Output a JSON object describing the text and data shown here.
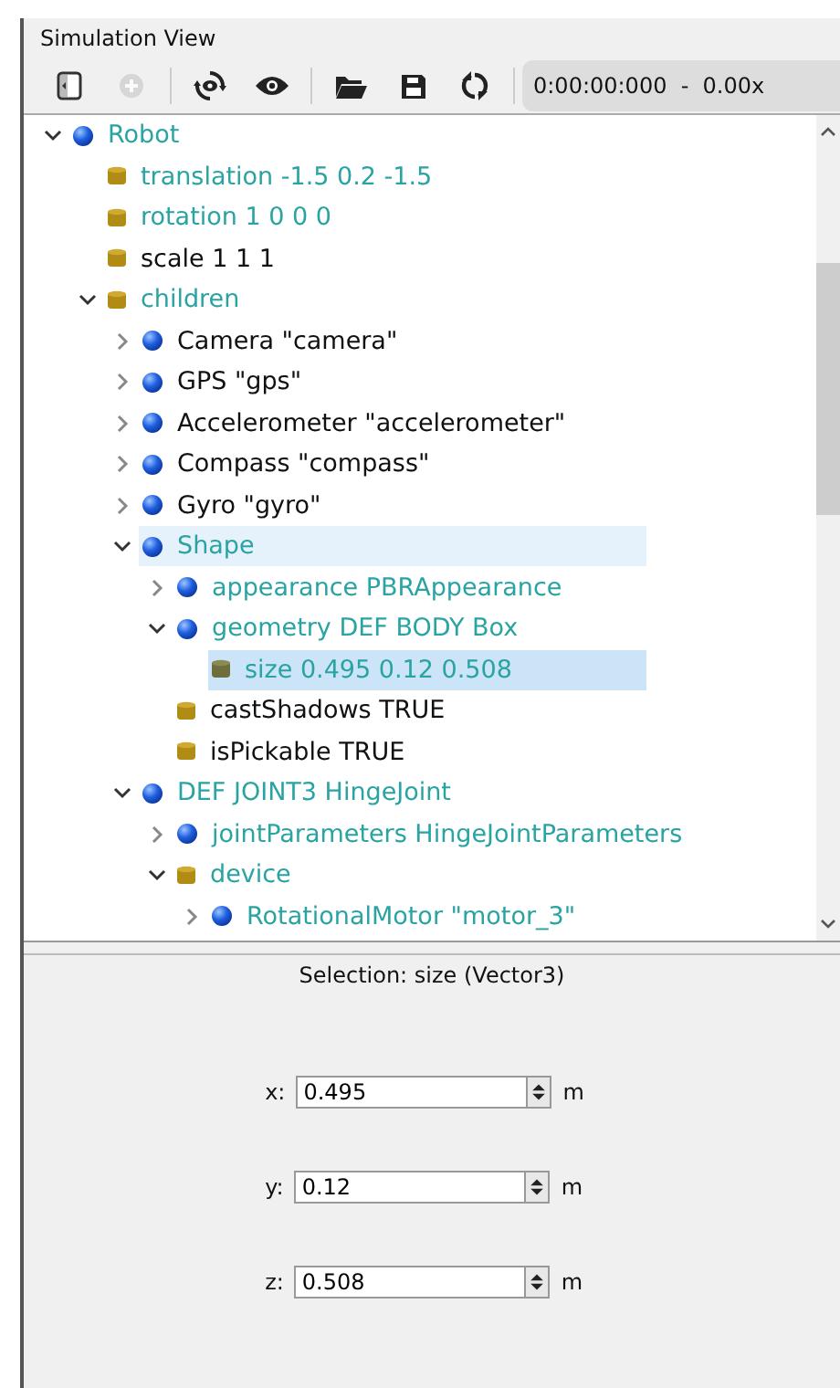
{
  "panel": {
    "title": "Simulation View"
  },
  "toolbar": {
    "buttons": [
      {
        "kind": "sidebar",
        "disabled": false
      },
      {
        "kind": "add",
        "disabled": true
      },
      {
        "kind": "sep"
      },
      {
        "kind": "reset-view",
        "disabled": false
      },
      {
        "kind": "eye",
        "disabled": false
      },
      {
        "kind": "sep"
      },
      {
        "kind": "open",
        "disabled": false
      },
      {
        "kind": "save",
        "disabled": false
      },
      {
        "kind": "reload",
        "disabled": false
      },
      {
        "kind": "sep"
      }
    ],
    "time": "0:00:00:000  -  0.00x"
  },
  "tree": [
    {
      "kind": "node",
      "label": "Robot",
      "color": "#2aa3a3",
      "expanded": true,
      "selected": false,
      "hovered": false,
      "children": [
        {
          "kind": "field",
          "label": "translation -1.5 0.2 -1.5",
          "color": "#2aa3a3",
          "selected": false,
          "hovered": false
        },
        {
          "kind": "field",
          "label": "rotation 1 0 0 0",
          "color": "#2aa3a3",
          "selected": false,
          "hovered": false
        },
        {
          "kind": "field",
          "label": "scale 1 1 1",
          "color": "#111111",
          "selected": false,
          "hovered": false
        },
        {
          "kind": "field",
          "label": "children",
          "color": "#2aa3a3",
          "expanded": true,
          "selected": false,
          "hovered": false,
          "children": [
            {
              "kind": "node",
              "label": "Camera \"camera\"",
              "color": "#111111",
              "expanded": false,
              "selected": false,
              "hovered": false
            },
            {
              "kind": "node",
              "label": "GPS \"gps\"",
              "color": "#111111",
              "expanded": false,
              "selected": false,
              "hovered": false
            },
            {
              "kind": "node",
              "label": "Accelerometer \"accelerometer\"",
              "color": "#111111",
              "expanded": false,
              "selected": false,
              "hovered": false
            },
            {
              "kind": "node",
              "label": "Compass \"compass\"",
              "color": "#111111",
              "expanded": false,
              "selected": false,
              "hovered": false
            },
            {
              "kind": "node",
              "label": "Gyro \"gyro\"",
              "color": "#111111",
              "expanded": false,
              "selected": false,
              "hovered": false
            },
            {
              "kind": "node",
              "label": "Shape",
              "color": "#2aa3a3",
              "expanded": true,
              "selected": false,
              "hovered": true,
              "children": [
                {
                  "kind": "node",
                  "label": "appearance PBRAppearance",
                  "color": "#2aa3a3",
                  "expanded": false,
                  "selected": false,
                  "hovered": false
                },
                {
                  "kind": "node",
                  "label": "geometry DEF BODY Box",
                  "color": "#2aa3a3",
                  "expanded": true,
                  "selected": false,
                  "hovered": false,
                  "children": [
                    {
                      "kind": "field",
                      "label": "size 0.495 0.12 0.508",
                      "color": "#2aa3a3",
                      "selected": true,
                      "hovered": false
                    }
                  ]
                },
                {
                  "kind": "field",
                  "label": "castShadows TRUE",
                  "color": "#111111",
                  "selected": false,
                  "hovered": false
                },
                {
                  "kind": "field",
                  "label": "isPickable TRUE",
                  "color": "#111111",
                  "selected": false,
                  "hovered": false
                }
              ]
            },
            {
              "kind": "node",
              "label": "DEF JOINT3 HingeJoint",
              "color": "#2aa3a3",
              "expanded": true,
              "selected": false,
              "hovered": false,
              "children": [
                {
                  "kind": "node",
                  "label": "jointParameters HingeJointParameters",
                  "color": "#2aa3a3",
                  "expanded": false,
                  "selected": false,
                  "hovered": false
                },
                {
                  "kind": "field",
                  "label": "device",
                  "color": "#2aa3a3",
                  "expanded": true,
                  "selected": false,
                  "hovered": false,
                  "children": [
                    {
                      "kind": "node",
                      "label": "RotationalMotor \"motor_3\"",
                      "color": "#2aa3a3",
                      "expanded": false,
                      "selected": false,
                      "hovered": false
                    }
                  ]
                }
              ]
            }
          ]
        }
      ]
    }
  ],
  "selection": {
    "title": "Selection: size (Vector3)",
    "fields": [
      {
        "label": "x:",
        "value": "0.495",
        "unit": "m"
      },
      {
        "label": "y:",
        "value": "0.12",
        "unit": "m"
      },
      {
        "label": "z:",
        "value": "0.508",
        "unit": "m"
      }
    ]
  }
}
